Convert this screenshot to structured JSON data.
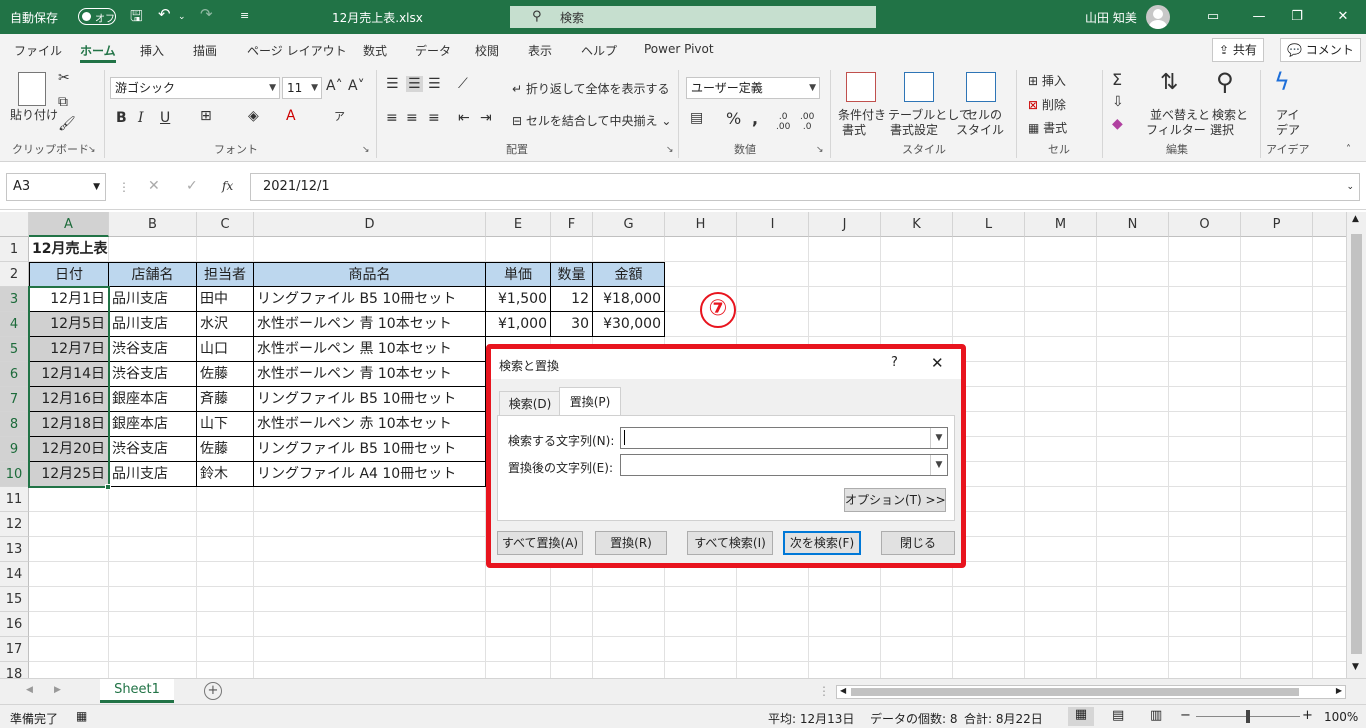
{
  "titlebar": {
    "autosave_label": "自動保存",
    "autosave_state": "オフ",
    "filename": "12月売上表.xlsx",
    "search_placeholder": "検索",
    "username": "山田 知美",
    "bg_color": "#217346"
  },
  "menu": {
    "tabs": [
      "ファイル",
      "ホーム",
      "挿入",
      "描画",
      "ページ レイアウト",
      "数式",
      "データ",
      "校閲",
      "表示",
      "ヘルプ",
      "Power Pivot"
    ],
    "active_tab": "ホーム",
    "share_label": "共有",
    "comment_label": "コメント"
  },
  "ribbon": {
    "clipboard": {
      "paste_label": "貼り付け",
      "group_label": "クリップボード"
    },
    "font": {
      "font_name": "游ゴシック",
      "font_size": "11",
      "group_label": "フォント",
      "bold": "B",
      "italic": "I",
      "underline": "U"
    },
    "alignment": {
      "wrap_label": "折り返して全体を表示する",
      "merge_label": "セルを結合して中央揃え",
      "group_label": "配置"
    },
    "number": {
      "format_value": "ユーザー定義",
      "group_label": "数値"
    },
    "styles": {
      "conditional_label_1": "条件付き",
      "conditional_label_2": "書式",
      "table_label_1": "テーブルとして",
      "table_label_2": "書式設定",
      "cellstyle_label_1": "セルの",
      "cellstyle_label_2": "スタイル",
      "group_label": "スタイル"
    },
    "cells": {
      "insert_label": "挿入",
      "delete_label": "削除",
      "format_label": "書式",
      "group_label": "セル"
    },
    "editing": {
      "sort_label_1": "並べ替えと",
      "sort_label_2": "フィルター",
      "find_label_1": "検索と",
      "find_label_2": "選択",
      "group_label": "編集"
    },
    "ideas": {
      "label_1": "アイ",
      "label_2": "デア",
      "group_label": "アイデア"
    }
  },
  "formula_bar": {
    "name_box": "A3",
    "formula": "2021/12/1",
    "fx": "fx"
  },
  "columns": [
    "A",
    "B",
    "C",
    "D",
    "E",
    "F",
    "G",
    "H",
    "I",
    "J",
    "K",
    "L",
    "M",
    "N",
    "O",
    "P"
  ],
  "rows": [
    "1",
    "2",
    "3",
    "4",
    "5",
    "6",
    "7",
    "8",
    "9",
    "10",
    "11",
    "12",
    "13",
    "14",
    "15",
    "16",
    "17",
    "18"
  ],
  "sheet": {
    "title": "12月売上表",
    "headers": [
      "日付",
      "店舗名",
      "担当者",
      "商品名",
      "単価",
      "数量",
      "金額"
    ],
    "data": [
      [
        "12月1日",
        "品川支店",
        "田中",
        "リングファイル B5 10冊セット",
        "¥1,500",
        "12",
        "¥18,000"
      ],
      [
        "12月5日",
        "品川支店",
        "水沢",
        "水性ボールペン 青 10本セット",
        "¥1,000",
        "30",
        "¥30,000"
      ],
      [
        "12月7日",
        "渋谷支店",
        "山口",
        "水性ボールペン 黒 10本セット"
      ],
      [
        "12月14日",
        "渋谷支店",
        "佐藤",
        "水性ボールペン 青 10本セット"
      ],
      [
        "12月16日",
        "銀座本店",
        "斉藤",
        "リングファイル B5 10冊セット"
      ],
      [
        "12月18日",
        "銀座本店",
        "山下",
        "水性ボールペン 赤 10本セット"
      ],
      [
        "12月20日",
        "渋谷支店",
        "佐藤",
        "リングファイル B5 10冊セット"
      ],
      [
        "12月25日",
        "品川支店",
        "鈴木",
        "リングファイル A4 10冊セット"
      ]
    ]
  },
  "annotation": "⑦",
  "dialog": {
    "title": "検索と置換",
    "help": "?",
    "close": "✕",
    "tabs": [
      "検索(D)",
      "置換(P)"
    ],
    "active_tab": "置換(P)",
    "find_label": "検索する文字列(N):",
    "replace_label": "置換後の文字列(E):",
    "find_value": "",
    "replace_value": "",
    "options_button": "オプション(T) >>",
    "buttons": [
      "すべて置換(A)",
      "置換(R)",
      "すべて検索(I)",
      "次を検索(F)",
      "閉じる"
    ],
    "highlight_color": "#e8141e"
  },
  "sheet_tabs": {
    "active": "Sheet1",
    "add": "+"
  },
  "status": {
    "ready": "準備完了",
    "average": "平均: 12月13日",
    "count": "データの個数: 8",
    "sum": "合計: 8月22日",
    "zoom": "100%",
    "zoom_minus": "−",
    "zoom_plus": "+"
  }
}
